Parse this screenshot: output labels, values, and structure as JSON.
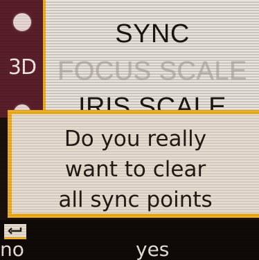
{
  "menu": {
    "items": [
      {
        "label": "SYNC",
        "state": "active"
      },
      {
        "label": "FOCUS SCALE",
        "state": "disabled"
      },
      {
        "label": "IRIS SCALE",
        "state": "partial"
      }
    ],
    "icons": [
      {
        "name": "dot-icon"
      },
      {
        "name": "3d-icon",
        "text": "3D"
      },
      {
        "name": "dot-icon"
      }
    ]
  },
  "dialog": {
    "lines": [
      "Do you really",
      "want to clear",
      "all sync points"
    ]
  },
  "softkeys": {
    "enter_icon": "enter-arrow-icon",
    "no_label": "no",
    "yes_label": "yes"
  },
  "colors": {
    "accent": "#f0b020",
    "icon_column": "#5a1f2a",
    "menu_background": "#e8e3dd",
    "dialog_background": "#e6ddd0",
    "text_dark": "#231a14",
    "text_dim": "#bdb6b0",
    "softkey_background": "#0f0a07",
    "softkey_text": "#e9e0d6"
  }
}
